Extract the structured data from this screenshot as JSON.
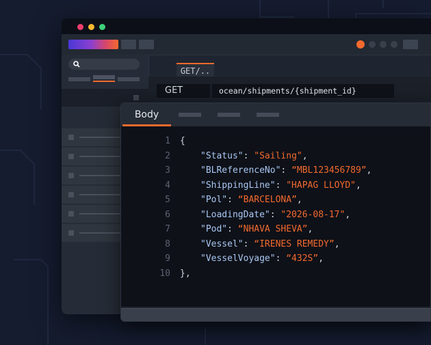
{
  "colors": {
    "accent": "#f36a2e",
    "key": "#a9c7f2",
    "background": "#151c2f"
  },
  "request": {
    "tab_label": "GET/..",
    "method": "GET",
    "url": "ocean/shipments/{shipment_id}"
  },
  "body_tab": {
    "label": "Body"
  },
  "code": {
    "open_brace": "{",
    "close_brace": "},",
    "line_numbers": [
      "1",
      "2",
      "3",
      "4",
      "5",
      "6",
      "7",
      "8",
      "9",
      "10"
    ],
    "entries": [
      {
        "key": "\"Status\"",
        "value": "\"Sailing\"",
        "sep": ","
      },
      {
        "key": "\"BLReferenceNo\"",
        "value": "“MBL123456789”",
        "sep": ","
      },
      {
        "key": "\"ShippingLine\"",
        "value": "\"HAPAG LLOYD\"",
        "sep": ","
      },
      {
        "key": "\"Pol\"",
        "value": "“BARCELONA”",
        "sep": ","
      },
      {
        "key": "\"LoadingDate\"",
        "value": "\"2026-08-17\"",
        "sep": ","
      },
      {
        "key": "\"Pod\"",
        "value": "“NHAVA SHEVA”",
        "sep": ","
      },
      {
        "key": "\"Vessel\"",
        "value": "“IRENES REMEDY”",
        "sep": ","
      },
      {
        "key": "\"VesselVoyage\"",
        "value": "“432S”",
        "sep": ","
      }
    ]
  },
  "icons": {
    "search": "search-icon"
  }
}
